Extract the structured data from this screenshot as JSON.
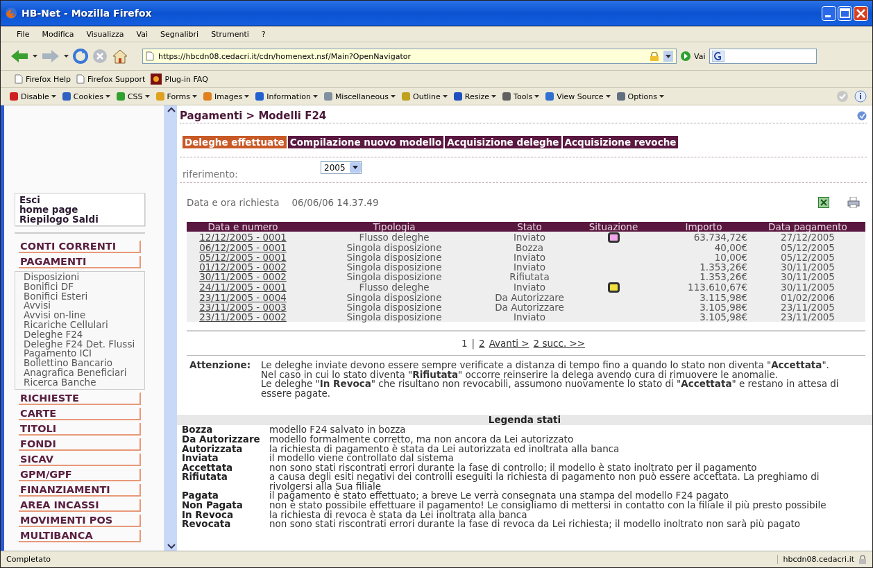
{
  "window": {
    "title": "HB-Net - Mozilla Firefox"
  },
  "menu": [
    "File",
    "Modifica",
    "Visualizza",
    "Vai",
    "Segnalibri",
    "Strumenti",
    "?"
  ],
  "address": {
    "value": "https://hbcdn08.cedacri.it/cdn/homenext.nsf/Main?OpenNavigator"
  },
  "go_button": "Vai",
  "bookmarks": [
    "Firefox Help",
    "Firefox Support",
    "Plug-in FAQ"
  ],
  "dev_toolbar": [
    "Disable",
    "Cookies",
    "CSS",
    "Forms",
    "Images",
    "Information",
    "Miscellaneous",
    "Outline",
    "Resize",
    "Tools",
    "View Source",
    "Options"
  ],
  "sidebar": {
    "quick_links": [
      "Esci",
      "home page",
      "Riepilogo Saldi"
    ],
    "sections": [
      {
        "label": "CONTI CORRENTI"
      },
      {
        "label": "PAGAMENTI",
        "children": [
          "Disposizioni",
          "Bonifici DF",
          "Bonifici Esteri",
          "Avvisi",
          "Avvisi on-line",
          "Ricariche Cellulari",
          "Deleghe F24",
          "Deleghe F24 Det. Flussi",
          "Pagamento ICI",
          "Bollettino Bancario",
          "Anagrafica Beneficiari",
          "Ricerca Banche"
        ]
      },
      {
        "label": "RICHIESTE"
      },
      {
        "label": "CARTE"
      },
      {
        "label": "TITOLI"
      },
      {
        "label": "FONDI"
      },
      {
        "label": "SICAV"
      },
      {
        "label": "GPM/GPF"
      },
      {
        "label": "FINANZIAMENTI"
      },
      {
        "label": "AREA INCASSI"
      },
      {
        "label": "MOVIMENTI POS"
      },
      {
        "label": "MULTIBANCA"
      }
    ]
  },
  "breadcrumb": "Pagamenti > Modelli F24",
  "tabs": [
    {
      "label": "Deleghe effettuate",
      "selected": true
    },
    {
      "label": "Compilazione nuovo modello",
      "selected": false
    },
    {
      "label": "Acquisizione deleghe",
      "selected": false
    },
    {
      "label": "Acquisizione revoche",
      "selected": false
    }
  ],
  "period": {
    "label": "riferimento:",
    "value": "2005"
  },
  "request": {
    "label": "Data e ora richiesta",
    "value": "06/06/06 14.37.49"
  },
  "table": {
    "columns": [
      "Data e numero",
      "Tipologia",
      "Stato",
      "Situazione",
      "Importo",
      "Data pagamento"
    ],
    "rows": [
      {
        "number": "12/12/2005 - 0001",
        "type": "Flusso deleghe",
        "status": "Inviato",
        "color": "#f0a8e8",
        "amount": "63.734,72€",
        "payment_date": "27/12/2005"
      },
      {
        "number": "06/12/2005 - 0001",
        "type": "Singola disposizione",
        "status": "Bozza",
        "amount": "40,00€",
        "payment_date": "05/12/2005"
      },
      {
        "number": "05/12/2005 - 0001",
        "type": "Singola disposizione",
        "status": "Inviato",
        "amount": "10,00€",
        "payment_date": "05/12/2005"
      },
      {
        "number": "01/12/2005 - 0002",
        "type": "Singola disposizione",
        "status": "Inviato",
        "amount": "1.353,26€",
        "payment_date": "30/11/2005"
      },
      {
        "number": "30/11/2005 - 0002",
        "type": "Singola disposizione",
        "status": "Rifiutata",
        "amount": "1.353,26€",
        "payment_date": "30/11/2005"
      },
      {
        "number": "24/11/2005 - 0001",
        "type": "Flusso deleghe",
        "status": "Inviato",
        "color": "#f0e040",
        "amount": "113.610,67€",
        "payment_date": "30/11/2005"
      },
      {
        "number": "23/11/2005 - 0004",
        "type": "Singola disposizione",
        "status": "Da Autorizzare",
        "amount": "3.115,98€",
        "payment_date": "01/02/2006"
      },
      {
        "number": "23/11/2005 - 0003",
        "type": "Singola disposizione",
        "status": "Da Autorizzare",
        "amount": "3.105,98€",
        "payment_date": "23/11/2005"
      },
      {
        "number": "23/11/2005 - 0002",
        "type": "Singola disposizione",
        "status": "Inviato",
        "amount": "3.105,98€",
        "payment_date": "23/11/2005"
      }
    ]
  },
  "pagination": [
    {
      "label": "1",
      "kind": "current"
    },
    {
      "label": "|",
      "kind": "separator"
    },
    {
      "label": "2",
      "kind": "link"
    },
    {
      "label": "Avanti >",
      "kind": "link"
    },
    {
      "label": "2 succ. >>",
      "kind": "link"
    }
  ],
  "notice": {
    "label": "Attenzione:",
    "paragraphs": [
      "Le deleghe inviate devono essere sempre verificate a distanza di tempo fino a quando lo stato non diventa \"**Accettata**\".",
      "Nel caso in cui lo stato diventa \"**Rifiutata**\" occorre reinserire la delega avendo cura di rimuovere le anomalie.",
      "Le deleghe \"**In Revoca**\" che risultano non revocabili, assumono nuovamente lo stato di \"**Accettata**\" e restano in attesa di essere pagate."
    ]
  },
  "legend": {
    "title": "Legenda stati",
    "items": [
      {
        "term": "Bozza",
        "description": "modello F24 salvato in bozza"
      },
      {
        "term": "Da Autorizzare",
        "description": "modello formalmente corretto, ma non ancora da Lei autorizzato"
      },
      {
        "term": "Autorizzata",
        "description": "la richiesta di pagamento è stata da Lei autorizzata ed inoltrata alla banca"
      },
      {
        "term": "Inviata",
        "description": "il modello viene controllato dal sistema"
      },
      {
        "term": "Accettata",
        "description": "non sono stati riscontrati errori durante la fase di controllo; il modello è stato inoltrato per il pagamento"
      },
      {
        "term": "Rifiutata",
        "description": "a causa degli esiti negativi dei controlli eseguiti la richiesta di pagamento non può essere accettata. La preghiamo di rivolgersi alla Sua filiale"
      },
      {
        "term": "Pagata",
        "description": "il pagamento è stato effettuato; a breve Le verrà consegnata una stampa del modello F24 pagato"
      },
      {
        "term": "Non Pagata",
        "description": "non è stato possibile effettuare il pagamento! Le consigliamo di mettersi in contatto con la filiale il più presto possibile"
      },
      {
        "term": "In Revoca",
        "description": "la richiesta di revoca è stata da Lei inoltrata alla banca"
      },
      {
        "term": "Revocata",
        "description": "non sono stati riscontrati errori durante la fase di revoca da Lei richiesta; il modello inoltrato non sarà più pagato"
      }
    ]
  },
  "status_bar": {
    "text": "Completato",
    "host": "hbcdn08.cedacri.it"
  }
}
